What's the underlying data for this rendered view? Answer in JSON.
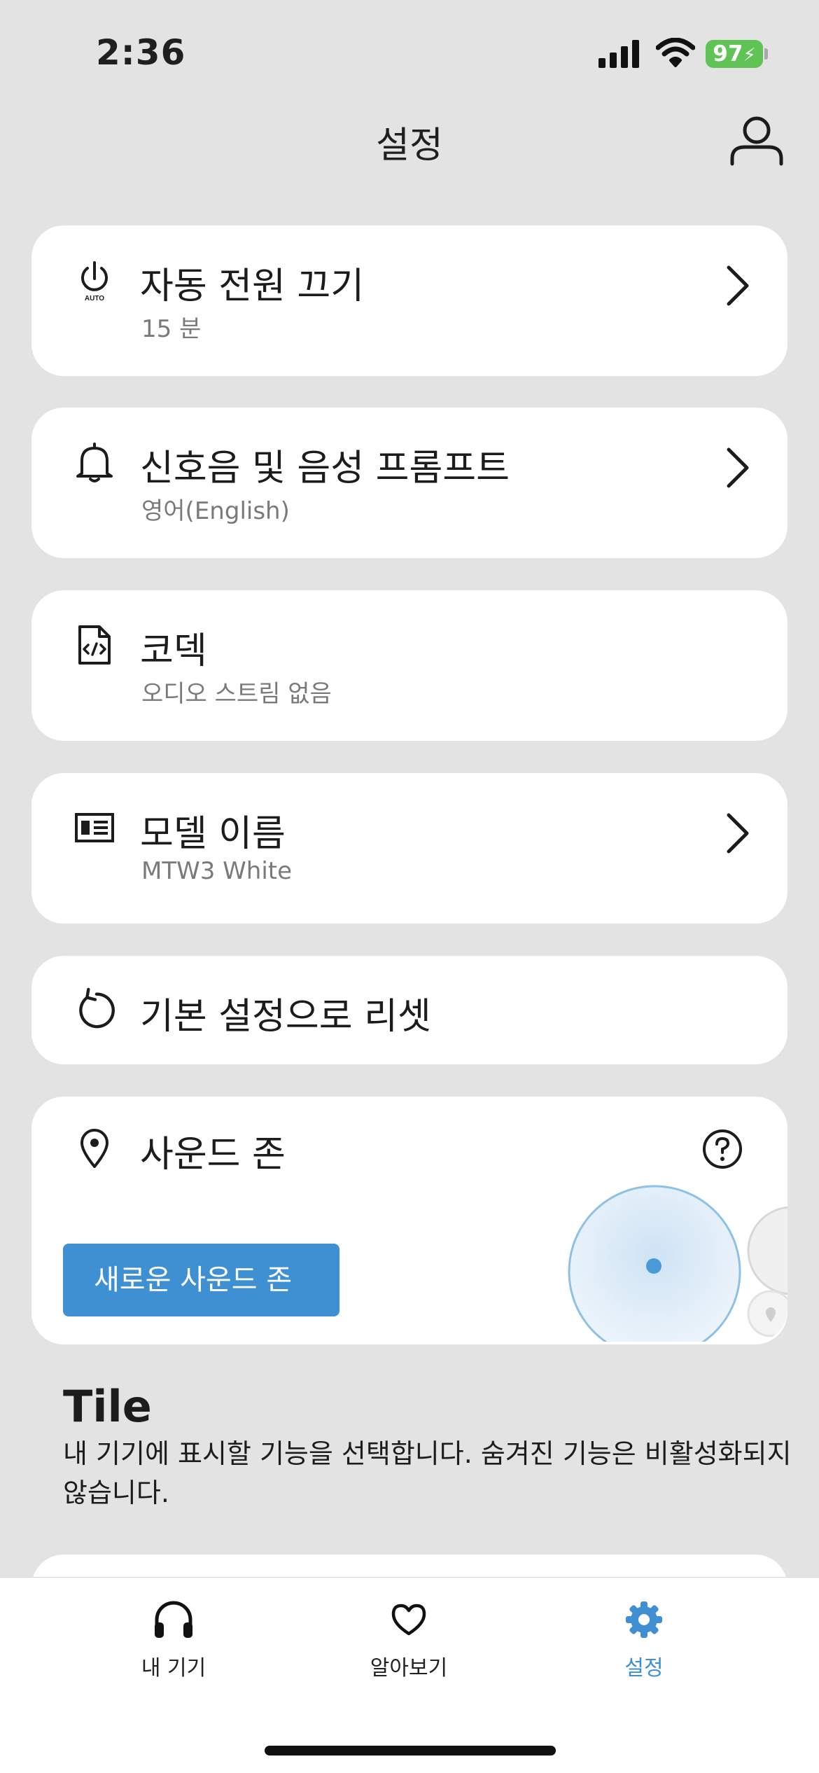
{
  "status": {
    "time": "2:36",
    "battery": "97"
  },
  "header": {
    "title": "설정"
  },
  "settings": {
    "auto_off": {
      "title": "자동 전원 끄기",
      "subtitle": "15 분",
      "icon_caption": "AUTO"
    },
    "prompts": {
      "title": "신호음 및 음성 프롬프트",
      "subtitle": "영어(English)"
    },
    "codec": {
      "title": "코덱",
      "subtitle": "오디오 스트림 없음"
    },
    "model": {
      "title": "모델 이름",
      "subtitle": "MTW3 White"
    },
    "reset": {
      "title": "기본 설정으로 리셋"
    }
  },
  "sound_zone": {
    "title": "사운드 존",
    "button_label": "새로운 사운드 존"
  },
  "tile": {
    "title": "Tile",
    "description": "내 기기에 표시할 기능을 선택합니다. 숨겨진 기능은 비활성화되지 않습니다."
  },
  "tabs": [
    {
      "label": "내 기기",
      "icon": "headphones-icon"
    },
    {
      "label": "알아보기",
      "icon": "heart-icon"
    },
    {
      "label": "설정",
      "icon": "gear-icon"
    }
  ],
  "colors": {
    "accent": "#3f8fd3",
    "background": "#e3e3e3",
    "battery": "#5fc356"
  }
}
